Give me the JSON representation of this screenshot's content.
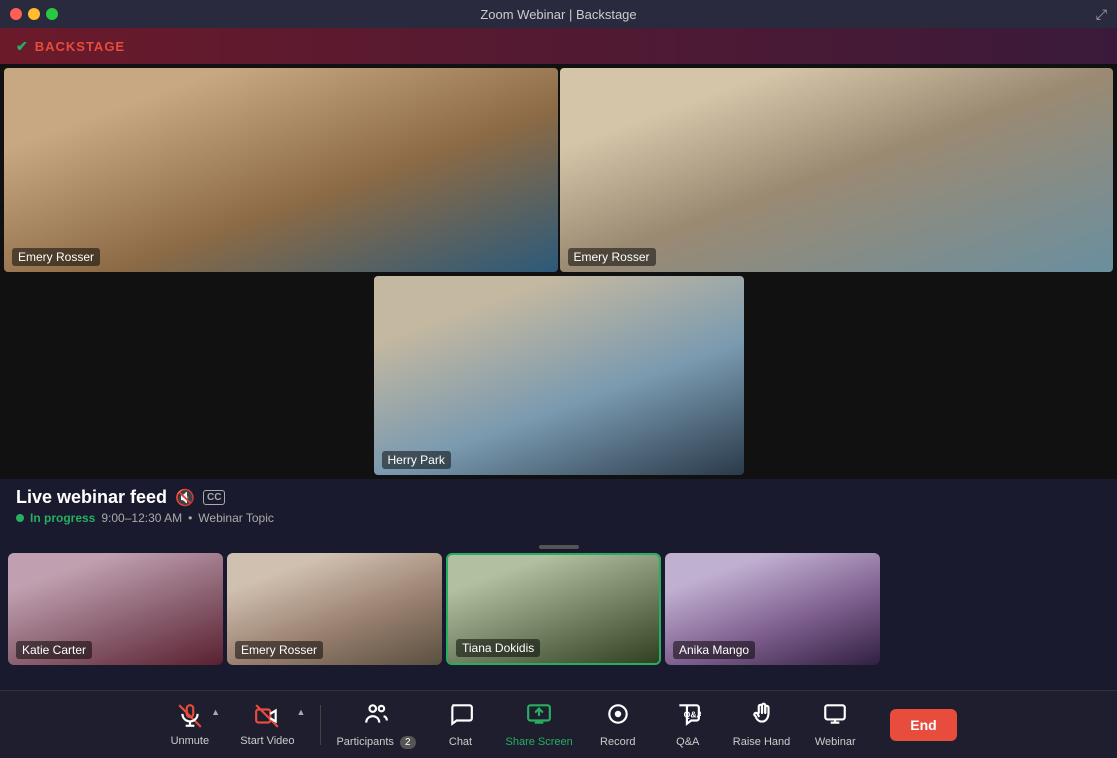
{
  "window": {
    "title": "Zoom Webinar | Backstage"
  },
  "backstage": {
    "label": "BACKSTAGE"
  },
  "video_feeds": {
    "top_left": {
      "name": "Emery Rosser",
      "bg_class": "vid-woman-waving"
    },
    "top_right": {
      "name": "Emery Rosser",
      "bg_class": "vid-three-people"
    },
    "center": {
      "name": "Herry Park",
      "bg_class": "vid-headphones-man"
    }
  },
  "live_feed": {
    "title": "Live webinar feed",
    "status": "In progress",
    "time": "9:00–12:30 AM",
    "topic": "Webinar Topic"
  },
  "participants": [
    {
      "name": "Katie Carter",
      "bg_class": "part-bg-1",
      "active": false
    },
    {
      "name": "Emery Rosser",
      "bg_class": "part-bg-2",
      "active": false
    },
    {
      "name": "Tiana Dokidis",
      "bg_class": "part-bg-3",
      "active": true
    },
    {
      "name": "Anika Mango",
      "bg_class": "part-bg-4",
      "active": false
    }
  ],
  "toolbar": {
    "unmute_label": "Unmute",
    "start_video_label": "Start Video",
    "participants_label": "Participants",
    "participants_count": "2",
    "chat_label": "Chat",
    "share_screen_label": "Share Screen",
    "record_label": "Record",
    "qa_label": "Q&A",
    "raise_hand_label": "Raise Hand",
    "webinar_label": "Webinar",
    "end_label": "End"
  }
}
